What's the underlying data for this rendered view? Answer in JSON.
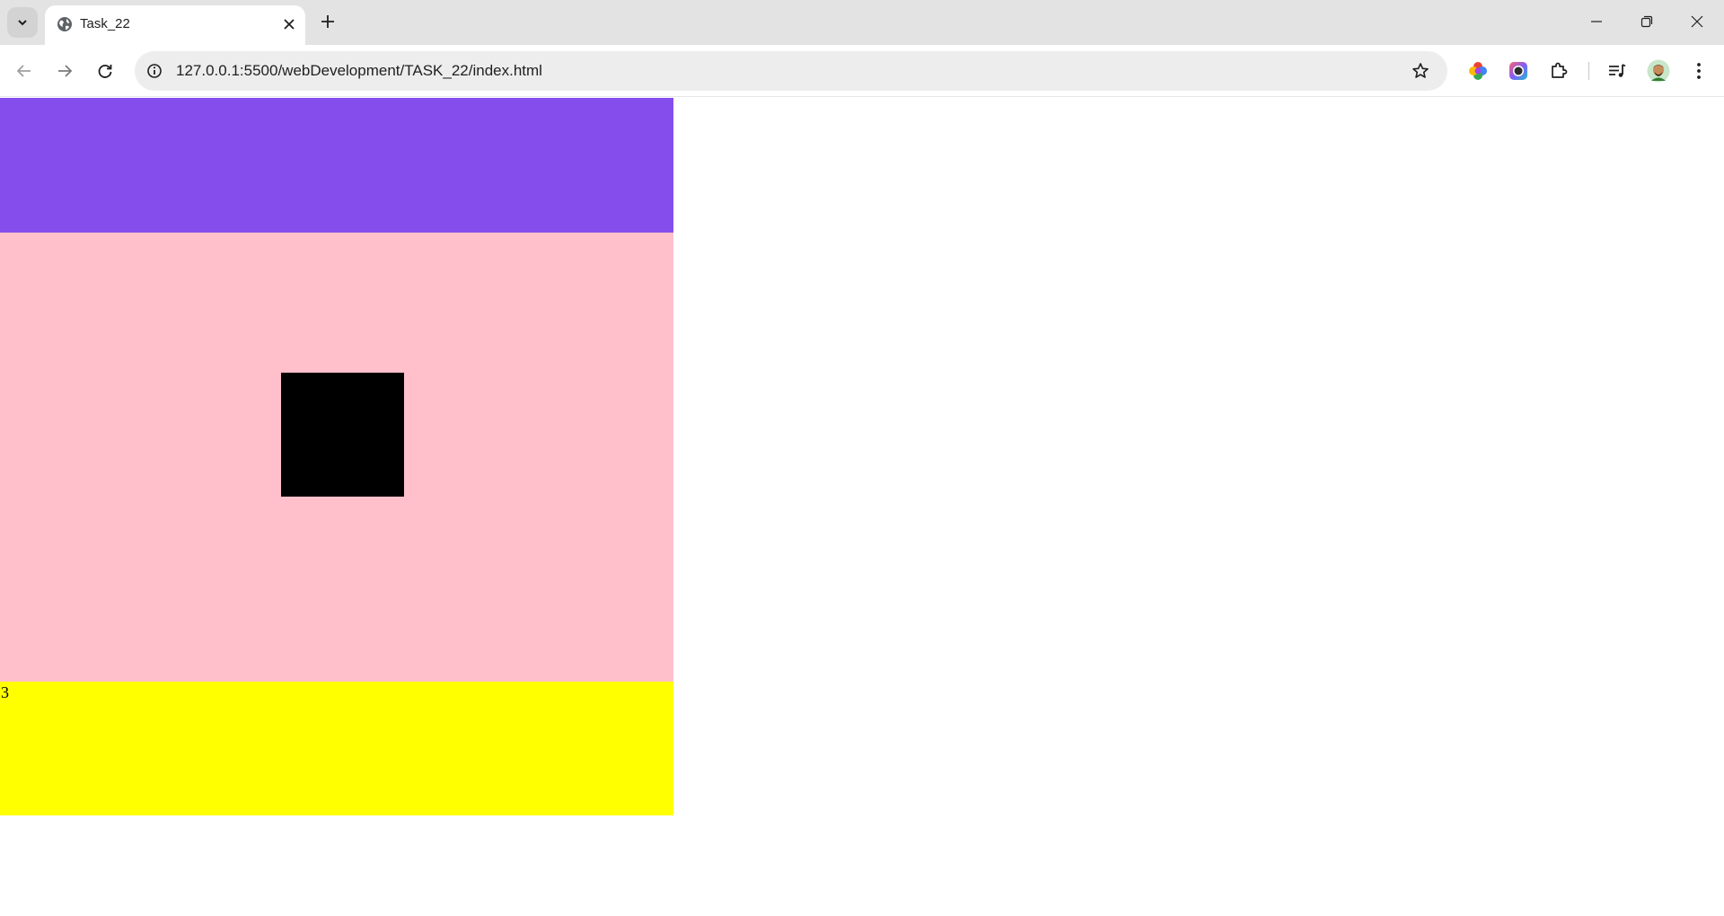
{
  "browser": {
    "tab": {
      "title": "Task_22",
      "favicon": "globe-icon"
    },
    "url": "127.0.0.1:5500/webDevelopment/TASK_22/index.html",
    "icons": {
      "tab_search": "chevron-down-icon",
      "tab_close": "close-icon",
      "new_tab": "plus-icon",
      "minimize": "minimize-icon",
      "restore": "restore-icon",
      "close_window": "close-icon",
      "back": "arrow-left-icon",
      "forward": "arrow-right-icon",
      "reload": "reload-icon",
      "site_info": "info-icon",
      "bookmark": "star-icon",
      "extensions": [
        "color-wheel-extension-icon",
        "camera-extension-icon",
        "puzzle-extensions-icon"
      ],
      "media": "media-controls-icon",
      "profile": "avatar",
      "menu": "more-vertical-icon"
    }
  },
  "page": {
    "colors": {
      "top_box": "#864ded",
      "middle_box": "#ffc0cb",
      "inner_box": "#000000",
      "bottom_box": "#ffff00"
    },
    "bottom_box_text": "3"
  }
}
